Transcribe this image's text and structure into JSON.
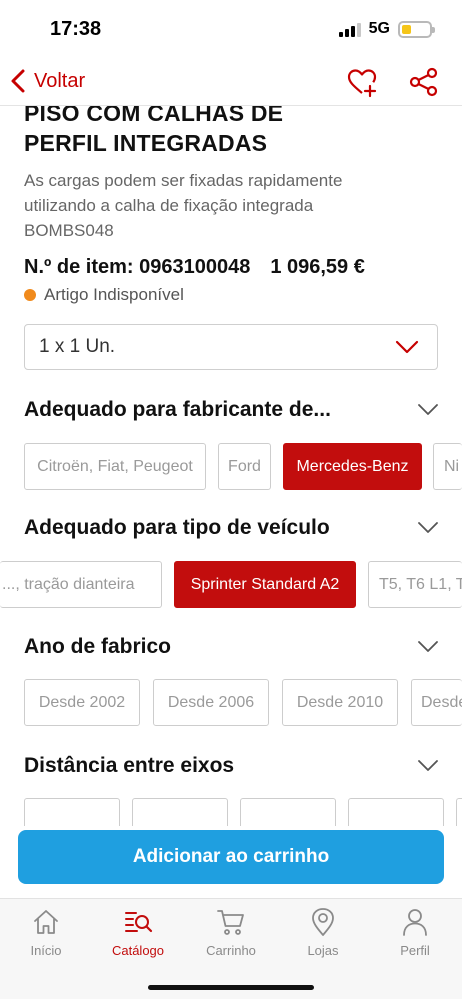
{
  "status": {
    "time": "17:38",
    "network": "5G"
  },
  "nav": {
    "back_label": "Voltar",
    "icons": [
      "heart-plus-icon",
      "share-icon"
    ]
  },
  "product": {
    "title_line1": "PISO COM CALHAS DE",
    "title_line2": "PERFIL INTEGRADAS",
    "description_line1": "As cargas podem ser fixadas rapidamente",
    "description_line2": "utilizando a calha de fixação integrada",
    "code": "BOMBS048",
    "item_number": "N.º de item: 0963100048",
    "price": "1 096,59 €",
    "availability": "Artigo Indisponível",
    "availability_color": "#f08a1c"
  },
  "quantity": {
    "value": "1 x 1 Un."
  },
  "sections": {
    "manufacturer": {
      "title": "Adequado para fabricante de...",
      "options": [
        "Citroën, Fiat, Peugeot",
        "Ford",
        "Mercedes-Benz",
        "Ni"
      ],
      "selected": "Mercedes-Benz"
    },
    "vehicle": {
      "title": "Adequado para tipo de veículo",
      "options": [
        "..., tração dianteira",
        "Sprinter Standard A2",
        "T5, T6 L1, T"
      ],
      "selected": "Sprinter Standard A2"
    },
    "year": {
      "title": "Ano de fabrico",
      "options": [
        "Desde 2002",
        "Desde 2006",
        "Desde 2010",
        "Desde"
      ]
    },
    "wheelbase": {
      "title": "Distância entre eixos"
    }
  },
  "cart_button": {
    "label": "Adicionar ao carrinho",
    "color": "#1f9fe0"
  },
  "tabs": [
    {
      "label": "Início",
      "icon": "home-icon"
    },
    {
      "label": "Catálogo",
      "icon": "catalog-search-icon",
      "active": true
    },
    {
      "label": "Carrinho",
      "icon": "cart-icon"
    },
    {
      "label": "Lojas",
      "icon": "location-pin-icon"
    },
    {
      "label": "Perfil",
      "icon": "user-icon"
    }
  ],
  "accent_color": "#c20d0d"
}
